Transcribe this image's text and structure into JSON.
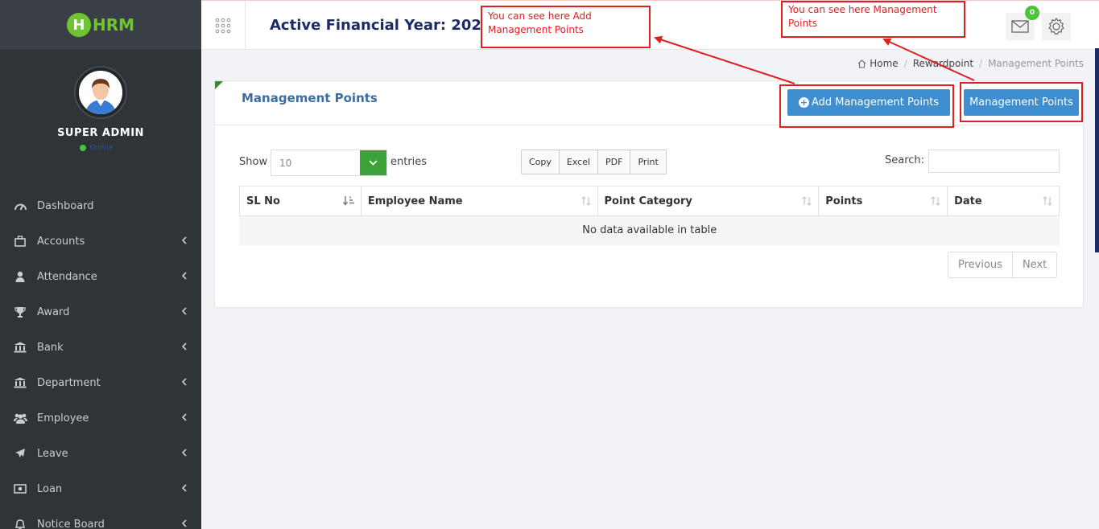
{
  "app": {
    "logo_letter": "H",
    "logo_text": "HRM"
  },
  "profile": {
    "name": "SUPER ADMIN",
    "status": "Online"
  },
  "sidebar": {
    "items": [
      {
        "label": "Dashboard",
        "icon": "dashboard-icon",
        "has_submenu": false
      },
      {
        "label": "Accounts",
        "icon": "briefcase-icon",
        "has_submenu": true
      },
      {
        "label": "Attendance",
        "icon": "user-icon",
        "has_submenu": true
      },
      {
        "label": "Award",
        "icon": "trophy-icon",
        "has_submenu": true
      },
      {
        "label": "Bank",
        "icon": "bank-icon",
        "has_submenu": true
      },
      {
        "label": "Department",
        "icon": "bank-icon",
        "has_submenu": true
      },
      {
        "label": "Employee",
        "icon": "users-icon",
        "has_submenu": true
      },
      {
        "label": "Leave",
        "icon": "plane-icon",
        "has_submenu": true
      },
      {
        "label": "Loan",
        "icon": "money-icon",
        "has_submenu": true
      },
      {
        "label": "Notice Board",
        "icon": "bell-icon",
        "has_submenu": true
      }
    ]
  },
  "topbar": {
    "title": "Active Financial Year: 2022",
    "mail_count": "0"
  },
  "breadcrumb": {
    "home": "Home",
    "parent": "Rewardpoint",
    "current": "Management Points"
  },
  "panel": {
    "title": "Management Points",
    "add_button": "Add Management Points",
    "list_button": "Management Points"
  },
  "table_controls": {
    "show_label": "Show",
    "page_length": "10",
    "entries_label": "entries",
    "export_buttons": [
      "Copy",
      "Excel",
      "PDF",
      "Print"
    ],
    "search_label": "Search:",
    "search_value": ""
  },
  "table": {
    "columns": [
      "SL No",
      "Employee Name",
      "Point Category",
      "Points",
      "Date"
    ],
    "empty_message": "No data available in table"
  },
  "pagination": {
    "previous": "Previous",
    "next": "Next"
  },
  "annotations": {
    "add_note": "You can see here Add Management Points",
    "list_note": "You can see here Management Points",
    "color": "#e02020"
  },
  "colors": {
    "sidebar": "#2f3439",
    "accent_green": "#3ba23a",
    "primary_blue": "#3e8ed0",
    "title_navy": "#1e2a66"
  }
}
